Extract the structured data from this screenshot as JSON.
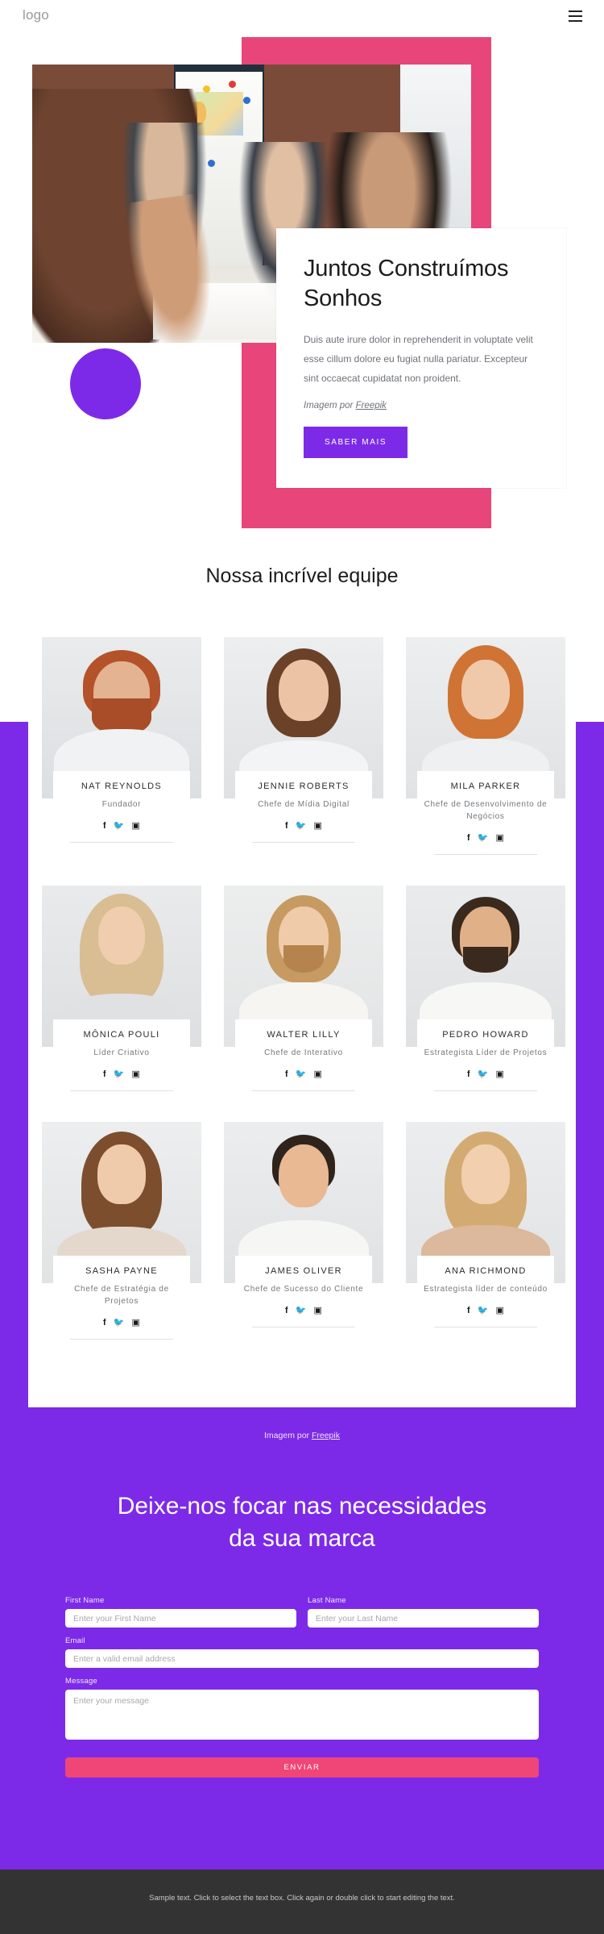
{
  "header": {
    "logo": "logo",
    "menu_icon": "hamburger-menu-icon"
  },
  "hero": {
    "title": "Juntos Construímos Sonhos",
    "paragraph": "Duis aute irure dolor in reprehenderit in voluptate velit esse cillum dolore eu fugiat nulla pariatur. Excepteur sint occaecat cupidatat non proident.",
    "credit_prefix": "Imagem por ",
    "credit_link": "Freepik",
    "cta_label": "SABER MAIS",
    "accent_pink": "#e8457b",
    "accent_purple": "#7d2ae8"
  },
  "team": {
    "heading": "Nossa incrível equipe",
    "social_icons": [
      "facebook-icon",
      "twitter-icon",
      "instagram-icon"
    ],
    "members": [
      {
        "name": "NAT REYNOLDS",
        "role": "Fundador"
      },
      {
        "name": "JENNIE ROBERTS",
        "role": "Chefe de Mídia Digital"
      },
      {
        "name": "MILA PARKER",
        "role": "Chefe de Desenvolvimento de Negócios"
      },
      {
        "name": "MÔNICA POULI",
        "role": "Líder Criativo"
      },
      {
        "name": "WALTER LILLY",
        "role": "Chefe de Interativo"
      },
      {
        "name": "PEDRO HOWARD",
        "role": "Estrategista Líder de Projetos"
      },
      {
        "name": "SASHA PAYNE",
        "role": "Chefe de Estratégia de Projetos"
      },
      {
        "name": "JAMES OLIVER",
        "role": "Chefe de Sucesso do Cliente"
      },
      {
        "name": "ANA RICHMOND",
        "role": "Estrategista líder de conteúdo"
      }
    ]
  },
  "cta": {
    "credit_prefix": "Imagem por ",
    "credit_link": "Freepik",
    "heading": "Deixe-nos focar nas necessidades da sua marca",
    "form": {
      "first_name": {
        "label": "First Name",
        "placeholder": "Enter your First Name",
        "value": ""
      },
      "last_name": {
        "label": "Last Name",
        "placeholder": "Enter your Last Name",
        "value": ""
      },
      "email": {
        "label": "Email",
        "placeholder": "Enter a valid email address",
        "value": ""
      },
      "message": {
        "label": "Message",
        "placeholder": "Enter your message",
        "value": ""
      },
      "submit_label": "ENVIAR"
    },
    "background": "#7d2ae8",
    "submit_color": "#ef4677"
  },
  "footer": {
    "text": "Sample text. Click to select the text box. Click again or double click to start editing the text."
  }
}
